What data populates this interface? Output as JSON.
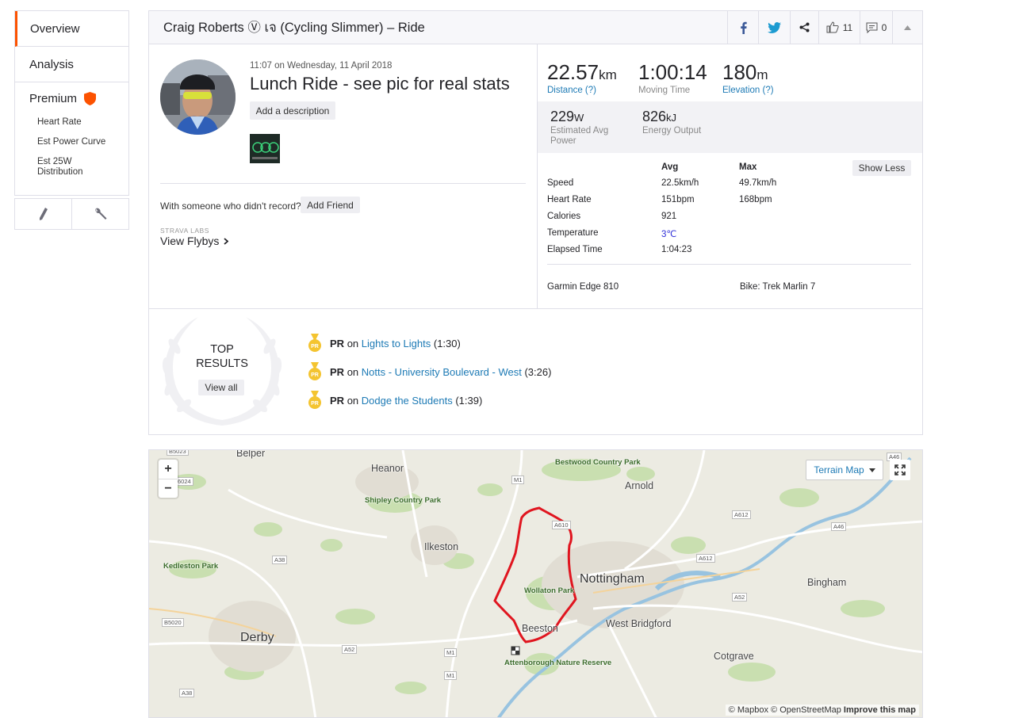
{
  "nav": {
    "overview": "Overview",
    "analysis": "Analysis",
    "premium": "Premium",
    "premium_items": [
      "Heart Rate",
      "Est Power Curve",
      "Est 25W Distribution"
    ]
  },
  "header": {
    "title": "Craig Roberts Ⓥ เจ (Cycling Slimmer) – Ride",
    "kudos_count": "11",
    "comment_count": "0"
  },
  "activity": {
    "time": "11:07 on Wednesday, 11 April 2018",
    "name": "Lunch Ride - see pic for real stats",
    "add_description": "Add a description",
    "friend_question": "With someone who didn't record?",
    "add_friend": "Add Friend",
    "labs": "STRAVA LABS",
    "flybys": "View Flybys"
  },
  "stats": {
    "distance": {
      "value": "22.57",
      "unit": "km",
      "label": "Distance (?)"
    },
    "moving_time": {
      "value": "1:00:14",
      "label": "Moving Time"
    },
    "elevation": {
      "value": "180",
      "unit": "m",
      "label": "Elevation (?)"
    },
    "power": {
      "value": "229",
      "unit": "W",
      "label": "Estimated Avg Power"
    },
    "energy": {
      "value": "826",
      "unit": "kJ",
      "label": "Energy Output"
    }
  },
  "details": {
    "headers": [
      "",
      "Avg",
      "Max"
    ],
    "show_less": "Show Less",
    "rows": [
      {
        "label": "Speed",
        "avg": "22.5km/h",
        "max": "49.7km/h"
      },
      {
        "label": "Heart Rate",
        "avg": "151bpm",
        "max": "168bpm"
      },
      {
        "label": "Calories",
        "avg": "921",
        "max": ""
      },
      {
        "label": "Temperature",
        "avg": "3℃",
        "max": ""
      },
      {
        "label": "Elapsed Time",
        "avg": "1:04:23",
        "max": ""
      }
    ],
    "device": "Garmin Edge 810",
    "bike": "Bike: Trek Marlin 7"
  },
  "results": {
    "title_line1": "TOP",
    "title_line2": "RESULTS",
    "view_all": "View all",
    "badge": "PR",
    "on": "on",
    "items": [
      {
        "badge": "PR",
        "segment": "Lights to Lights",
        "time": "(1:30)"
      },
      {
        "badge": "PR",
        "segment": "Notts - University Boulevard - West",
        "time": "(3:26)"
      },
      {
        "badge": "PR",
        "segment": "Dodge the Students",
        "time": "(1:39)"
      }
    ]
  },
  "map": {
    "zoom_in": "+",
    "zoom_out": "−",
    "terrain": "Terrain Map",
    "attribution_mapbox": "© Mapbox",
    "attribution_osm": "© OpenStreetMap",
    "attribution_improve": "Improve this map",
    "places": [
      "Belper",
      "Heanor",
      "Bestwood Country Park",
      "Arnold",
      "Shipley Country Park",
      "Ilkeston",
      "Kedleston Park",
      "Nottingham",
      "Wollaton Park",
      "Bingham",
      "Derby",
      "Beeston",
      "West Bridgford",
      "Attenborough Nature Reserve",
      "Cotgrave"
    ],
    "roads": [
      "B5023",
      "A6024",
      "M1",
      "A38",
      "A610",
      "A612",
      "A46",
      "B5020",
      "A52",
      "M1",
      "M1",
      "A52",
      "A38",
      "A612",
      "A46"
    ],
    "route_color": "#e0151f",
    "accent_color": "#fc5200",
    "link_color": "#1d7ab5"
  }
}
